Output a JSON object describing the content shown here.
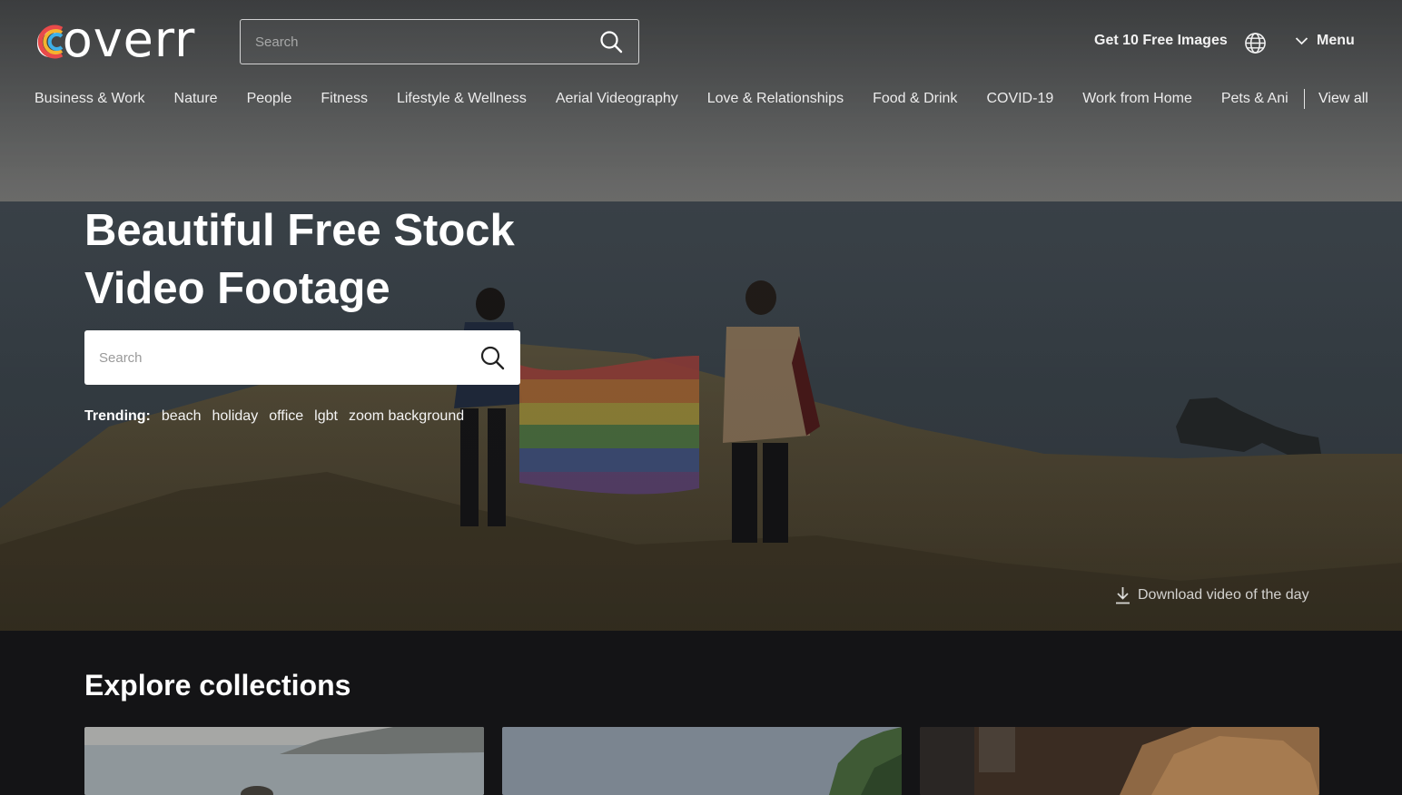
{
  "header": {
    "logo_text": "coverr",
    "search_placeholder": "Search",
    "free_images_label": "Get 10 Free Images",
    "language_icon": "globe-icon",
    "menu_label": "Menu"
  },
  "categories": [
    "Business & Work",
    "Nature",
    "People",
    "Fitness",
    "Lifestyle & Wellness",
    "Aerial Videography",
    "Love & Relationships",
    "Food & Drink",
    "COVID-19",
    "Work from Home",
    "Pets & Ani"
  ],
  "view_all_label": "View all",
  "hero": {
    "title_line1": "Beautiful Free Stock",
    "title_line2": "Video Footage",
    "search_placeholder": "Search",
    "trending_label": "Trending:",
    "trending_tags": [
      "beach",
      "holiday",
      "office",
      "lgbt",
      "zoom background"
    ],
    "download_label": "Download video of the day"
  },
  "collections": {
    "title": "Explore collections"
  },
  "colors": {
    "page_dark": "#141416",
    "hero_sky": "#6f7274",
    "hero_sea": "#4f5a63",
    "text": "#ffffff"
  }
}
